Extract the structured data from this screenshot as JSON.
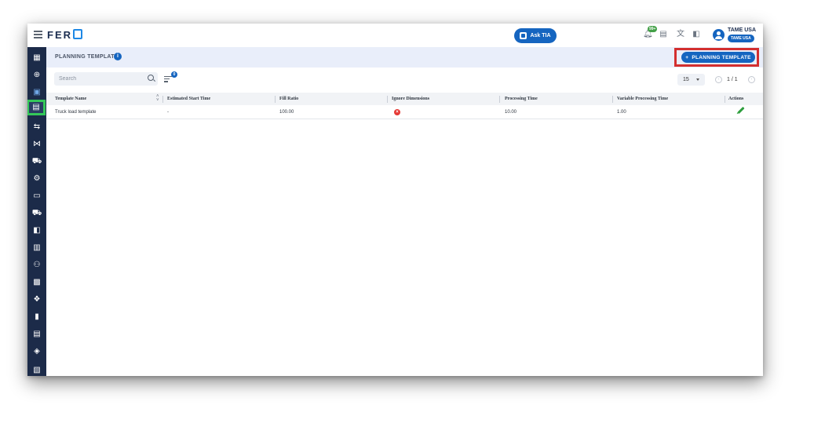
{
  "app": {
    "logo_text": "FER"
  },
  "topbar": {
    "ask_label": "Ask TIA",
    "notification_count": "99+",
    "user_name": "TAME USA",
    "user_org": "TAME USA"
  },
  "sidebar": {
    "items": [
      {
        "icon": "dashboard-icon",
        "glyph": "▦"
      },
      {
        "icon": "globe-icon",
        "glyph": "⊕"
      },
      {
        "icon": "calendar-icon",
        "glyph": "▣"
      },
      {
        "icon": "planning-template-icon",
        "glyph": "▤",
        "active": true
      },
      {
        "icon": "route-icon",
        "glyph": "⇆"
      },
      {
        "icon": "network-icon",
        "glyph": "⋈"
      },
      {
        "icon": "truck-search-icon",
        "glyph": "⛟"
      },
      {
        "icon": "settings-gears-icon",
        "glyph": "⚙"
      },
      {
        "icon": "card-icon",
        "glyph": "▭"
      },
      {
        "icon": "truck-icon",
        "glyph": "⛟"
      },
      {
        "icon": "columns-icon",
        "glyph": "◧"
      },
      {
        "icon": "building-icon",
        "glyph": "▥"
      },
      {
        "icon": "people-icon",
        "glyph": "⚇"
      },
      {
        "icon": "report-icon",
        "glyph": "▩"
      },
      {
        "icon": "cube-icon",
        "glyph": "❖"
      },
      {
        "icon": "trash-icon",
        "glyph": "▮"
      },
      {
        "icon": "gallery-icon",
        "glyph": "▤"
      },
      {
        "icon": "shield-icon",
        "glyph": "◈"
      },
      {
        "icon": "map-icon",
        "glyph": "▧"
      }
    ]
  },
  "page": {
    "title": "PLANNING TEMPLATE",
    "info_badge": "i",
    "add_button_label": "PLANNING TEMPLATE",
    "add_button_plus": "+"
  },
  "toolbar": {
    "search_placeholder": "Search",
    "filter_count": "0",
    "page_size": "15",
    "page_info": "1 / 1"
  },
  "table": {
    "columns": [
      "Template Name",
      "Estimated Start Time",
      "Fill Ratio",
      "Ignore Dimensions",
      "Processing Time",
      "Variable Processing Time",
      "Actions"
    ],
    "rows": [
      {
        "template_name": "Truck load template",
        "estimated_start_time": "-",
        "fill_ratio": "100.00",
        "ignore_dimensions": "false",
        "processing_time": "10.00",
        "variable_processing_time": "1.00"
      }
    ]
  },
  "colors": {
    "accent": "#1565c0",
    "sidebar_bg": "#1c2b49",
    "highlight_red": "#d32f2f",
    "highlight_green": "#34c759"
  }
}
